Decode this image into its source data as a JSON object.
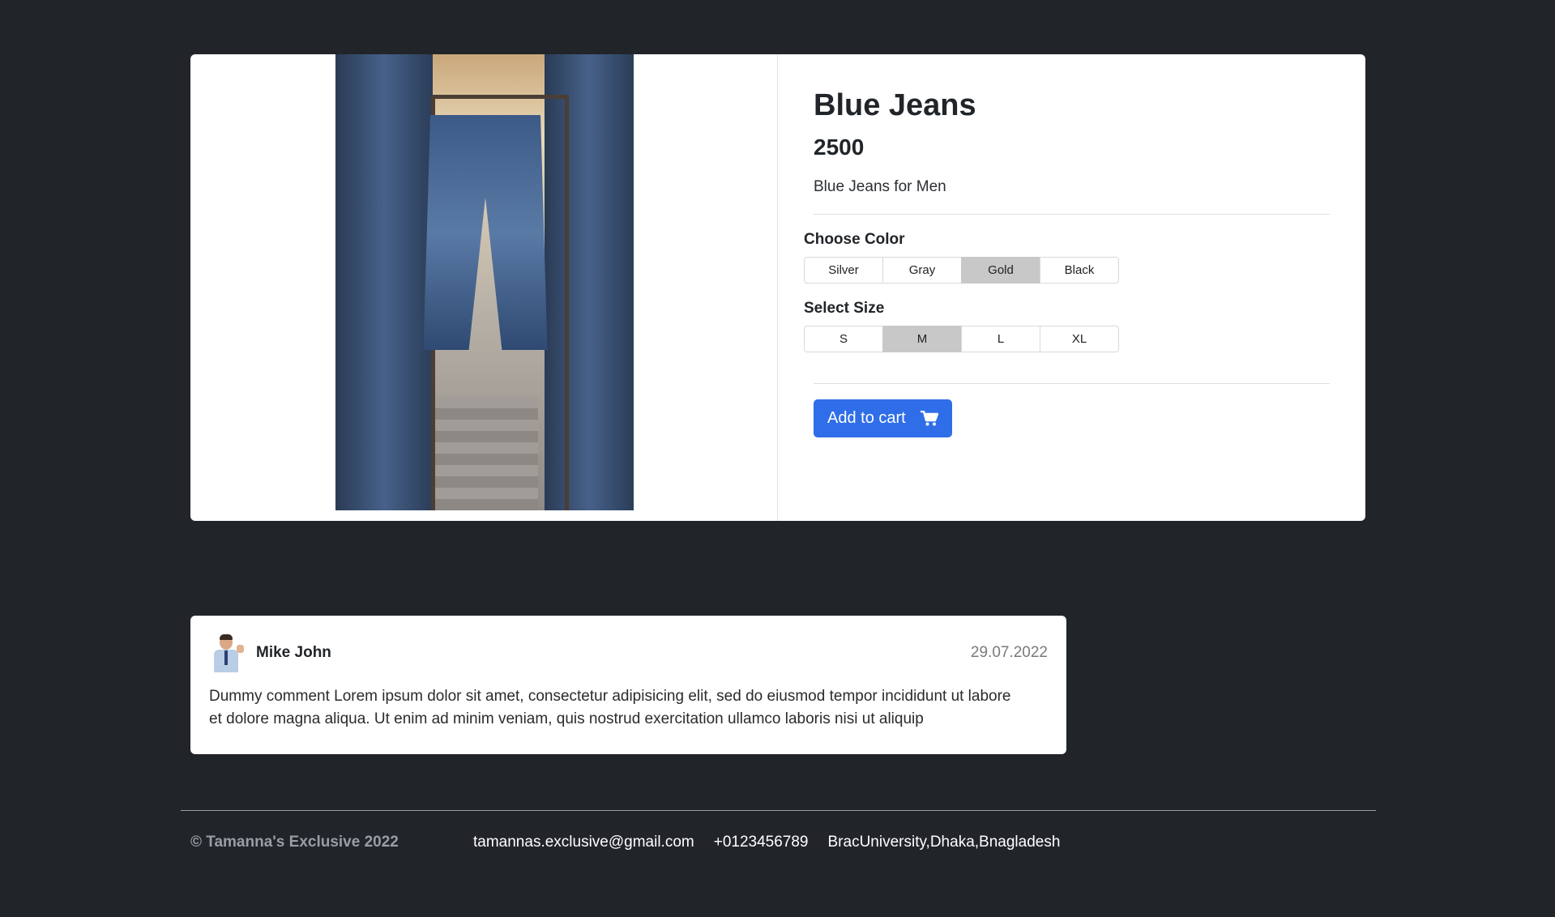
{
  "product": {
    "title": "Blue Jeans",
    "price": "2500",
    "description": "Blue Jeans for Men",
    "image_alt": "Blue jeans hanging on a rack"
  },
  "color_options": {
    "label": "Choose Color",
    "options": [
      "Silver",
      "Gray",
      "Gold",
      "Black"
    ],
    "selected": "Gold"
  },
  "size_options": {
    "label": "Select Size",
    "options": [
      "S",
      "M",
      "L",
      "XL"
    ],
    "selected": "M"
  },
  "cart": {
    "add_label": "Add to cart",
    "icon": "cart-icon",
    "button_color": "#2f6ee8"
  },
  "comment": {
    "author": "Mike John",
    "date": "29.07.2022",
    "text": "Dummy comment Lorem ipsum dolor sit amet, consectetur adipisicing elit, sed do eiusmod tempor incididunt ut labore et dolore magna aliqua. Ut enim ad minim veniam, quis nostrud exercitation ullamco laboris nisi ut aliquip"
  },
  "footer": {
    "copyright": "© Tamanna's Exclusive 2022",
    "email": "tamannas.exclusive@gmail.com",
    "phone": "+0123456789",
    "address": "BracUniversity,Dhaka,Bnagladesh"
  },
  "colors": {
    "page_background": "#212429",
    "selected_option": "#c8c8c8"
  }
}
